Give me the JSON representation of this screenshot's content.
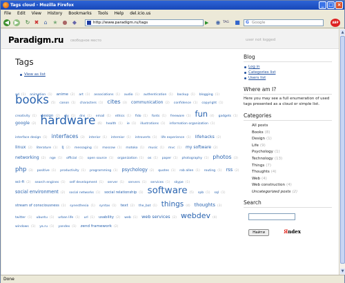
{
  "window": {
    "title": "Tags cloud - Mozilla Firefox"
  },
  "menu": [
    "File",
    "Edit",
    "View",
    "History",
    "Bookmarks",
    "Tools",
    "Help",
    "del.icio.us"
  ],
  "nav": {
    "url": "http://www.paradigm.ru/tags",
    "search_placeholder": "Google",
    "tab_label": "TAG"
  },
  "header": {
    "logo": "Paradigm.ru",
    "tagline": "свободное место",
    "user": "user not logged"
  },
  "main": {
    "title": "Tags",
    "view_as_list": "View as list"
  },
  "cloud_rows": [
    [
      {
        "t": "ad",
        "c": "1",
        "s": 4.6
      },
      {
        "t": "animation",
        "c": "1",
        "s": 4.6
      },
      {
        "t": "anime",
        "c": "2",
        "s": 5.6
      },
      {
        "t": "art",
        "c": "1",
        "s": 4.6
      },
      {
        "t": "associations",
        "c": "1",
        "s": 4.6
      },
      {
        "t": "audio",
        "c": "1",
        "s": 4.6
      },
      {
        "t": "authentication",
        "c": "1",
        "s": 4.6
      },
      {
        "t": "backup",
        "c": "1",
        "s": 4.6
      },
      {
        "t": "blogging",
        "c": "1",
        "s": 4.6
      }
    ],
    [
      {
        "t": "books",
        "c": "5",
        "s": 16.5
      },
      {
        "t": "canon",
        "c": "1",
        "s": 4.6
      },
      {
        "t": "characters",
        "c": "1",
        "s": 4.6
      },
      {
        "t": "cites",
        "c": "3",
        "s": 8.2
      },
      {
        "t": "communication",
        "c": "2",
        "s": 6
      },
      {
        "t": "confidence",
        "c": "1",
        "s": 4.6
      },
      {
        "t": "copyright",
        "c": "1",
        "s": 4.6
      }
    ],
    [
      {
        "t": "creativity",
        "c": "1",
        "s": 4.6
      },
      {
        "t": "design",
        "c": "2",
        "s": 5.6
      },
      {
        "t": "diy",
        "c": "1",
        "s": 4.6
      },
      {
        "t": "dns",
        "c": "1",
        "s": 4.6
      },
      {
        "t": "email",
        "c": "1",
        "s": 4.6
      },
      {
        "t": "ethics",
        "c": "1",
        "s": 4.6
      },
      {
        "t": "fido",
        "c": "1",
        "s": 4.6
      },
      {
        "t": "fonts",
        "c": "1",
        "s": 4.6
      },
      {
        "t": "freeware",
        "c": "1",
        "s": 4.6
      },
      {
        "t": "fun",
        "c": "4",
        "s": 11.5
      },
      {
        "t": "gadgets",
        "c": "1",
        "s": 4.6
      }
    ],
    [
      {
        "t": "google",
        "c": "2",
        "s": 6.2
      },
      {
        "t": "hardware",
        "c": "6",
        "s": 17
      },
      {
        "t": "health",
        "c": "1",
        "s": 4.6
      },
      {
        "t": "ie",
        "c": "1",
        "s": 4.6
      },
      {
        "t": "illustrations",
        "c": "1",
        "s": 4.6
      },
      {
        "t": "information organization",
        "c": "1",
        "s": 4.6
      }
    ],
    [
      {
        "t": "interface design",
        "c": "1",
        "s": 4.6
      },
      {
        "t": "interfaces",
        "c": "3",
        "s": 7.8
      },
      {
        "t": "interior",
        "c": "1",
        "s": 4.6
      },
      {
        "t": "internior",
        "c": "1",
        "s": 4.6
      },
      {
        "t": "introverts",
        "c": "1",
        "s": 4.6
      },
      {
        "t": "life experience",
        "c": "1",
        "s": 4.6
      },
      {
        "t": "lifehacks",
        "c": "2",
        "s": 6.4
      }
    ],
    [
      {
        "t": "linux",
        "c": "2",
        "s": 6.4
      },
      {
        "t": "literature",
        "c": "1",
        "s": 4.6
      },
      {
        "t": "lj",
        "c": "2",
        "s": 5.6
      },
      {
        "t": "messaging",
        "c": "1",
        "s": 4.6
      },
      {
        "t": "moscow",
        "c": "1",
        "s": 4.6
      },
      {
        "t": "motoko",
        "c": "1",
        "s": 4.6
      },
      {
        "t": "music",
        "c": "1",
        "s": 4.6
      },
      {
        "t": "mvc",
        "c": "1",
        "s": 4.6
      },
      {
        "t": "my software",
        "c": "2",
        "s": 6
      }
    ],
    [
      {
        "t": "networking",
        "c": "2",
        "s": 6.2
      },
      {
        "t": "nge",
        "c": "1",
        "s": 4.6
      },
      {
        "t": "official",
        "c": "1",
        "s": 4.6
      },
      {
        "t": "open source",
        "c": "1",
        "s": 4.6
      },
      {
        "t": "organization",
        "c": "1",
        "s": 4.6
      },
      {
        "t": "os",
        "c": "1",
        "s": 4.6
      },
      {
        "t": "paper",
        "c": "1",
        "s": 4.6
      },
      {
        "t": "photography",
        "c": "1",
        "s": 4.6
      },
      {
        "t": "photos",
        "c": "3",
        "s": 8
      }
    ],
    [
      {
        "t": "php",
        "c": "3",
        "s": 8.6
      },
      {
        "t": "positive",
        "c": "1",
        "s": 4.6
      },
      {
        "t": "productivity",
        "c": "1",
        "s": 4.6
      },
      {
        "t": "programming",
        "c": "1",
        "s": 4.6
      },
      {
        "t": "psychology",
        "c": "2",
        "s": 6.6
      },
      {
        "t": "quotes",
        "c": "1",
        "s": 4.6
      },
      {
        "t": "rob allen",
        "c": "1",
        "s": 4.6
      },
      {
        "t": "routing",
        "c": "1",
        "s": 4.6
      },
      {
        "t": "rss",
        "c": "2",
        "s": 6.6
      }
    ],
    [
      {
        "t": "sci-fi",
        "c": "2",
        "s": 5.6
      },
      {
        "t": "search engines",
        "c": "1",
        "s": 4.6
      },
      {
        "t": "self development",
        "c": "1",
        "s": 4.6
      },
      {
        "t": "server",
        "c": "1",
        "s": 4.6
      },
      {
        "t": "servers",
        "c": "1",
        "s": 4.6
      },
      {
        "t": "services",
        "c": "1",
        "s": 4.6
      },
      {
        "t": "skype",
        "c": "1",
        "s": 4.6
      }
    ],
    [
      {
        "t": "social environment",
        "c": "2",
        "s": 6.6
      },
      {
        "t": "social networks",
        "c": "1",
        "s": 4.6
      },
      {
        "t": "social relationship",
        "c": "1",
        "s": 5.2
      },
      {
        "t": "software",
        "c": "5",
        "s": 13.5
      },
      {
        "t": "spb",
        "c": "1",
        "s": 4.6
      },
      {
        "t": "sql",
        "c": "1",
        "s": 4.6
      }
    ],
    [
      {
        "t": "stream of consciousness",
        "c": "1",
        "s": 5.2
      },
      {
        "t": "synesthesia",
        "c": "1",
        "s": 4.6
      },
      {
        "t": "syntax",
        "c": "1",
        "s": 4.6
      },
      {
        "t": "text",
        "c": "2",
        "s": 5.6
      },
      {
        "t": "the_bat",
        "c": "1",
        "s": 4.6
      },
      {
        "t": "things",
        "c": "4",
        "s": 10.5
      },
      {
        "t": "thoughts",
        "c": "3",
        "s": 6.8
      }
    ],
    [
      {
        "t": "twitter",
        "c": "1",
        "s": 4.6
      },
      {
        "t": "ubuntu",
        "c": "1",
        "s": 4.6
      },
      {
        "t": "urban life",
        "c": "1",
        "s": 4.6
      },
      {
        "t": "url",
        "c": "1",
        "s": 4.6
      },
      {
        "t": "usability",
        "c": "2",
        "s": 5.2
      },
      {
        "t": "web",
        "c": "1",
        "s": 4.6
      },
      {
        "t": "web services",
        "c": "2",
        "s": 6.4
      },
      {
        "t": "webdev",
        "c": "4",
        "s": 11
      }
    ],
    [
      {
        "t": "windows",
        "c": "1",
        "s": 4.6
      },
      {
        "t": "ya.ru",
        "c": "1",
        "s": 4.6
      },
      {
        "t": "yandex",
        "c": "1",
        "s": 4.6
      },
      {
        "t": "zend framework",
        "c": "2",
        "s": 5.6
      }
    ]
  ],
  "sidebar": {
    "blog_title": "Blog",
    "blog_links": [
      "Log in",
      "Categories list",
      "Users list"
    ],
    "where_title": "Where am I?",
    "where_text": "Here you may see a full enumeration of used tags presented as a cloud or simple list.",
    "cat_title": "Categories",
    "categories": [
      {
        "name": "All posts",
        "count": ""
      },
      {
        "name": "Books",
        "count": "(8)"
      },
      {
        "name": "Design",
        "count": "(1)"
      },
      {
        "name": "Life",
        "count": "(9)"
      },
      {
        "name": "Psychology",
        "count": "(1)"
      },
      {
        "name": "Technology",
        "count": "(13)"
      },
      {
        "name": "Things",
        "count": "(7)"
      },
      {
        "name": "Thoughts",
        "count": "(4)"
      },
      {
        "name": "Web",
        "count": "(4)"
      },
      {
        "name": "Web construction",
        "count": "(4)"
      },
      {
        "name": "Uncategorized posts",
        "count": "(2)",
        "italic": true
      }
    ],
    "search_title": "Search",
    "search_button": "Найти",
    "yandex_y": "Я",
    "yandex_rest": "ndex"
  },
  "status": "Done"
}
